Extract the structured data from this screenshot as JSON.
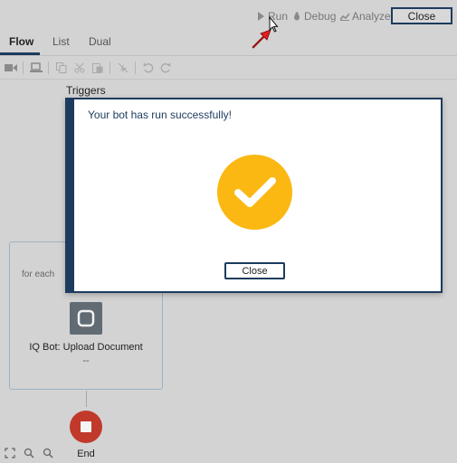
{
  "header": {
    "run_label": "Run",
    "debug_label": "Debug",
    "analyze_label": "Analyze",
    "close_label": "Close"
  },
  "tabs": [
    {
      "label": "Flow",
      "active": true
    },
    {
      "label": "List",
      "active": false
    },
    {
      "label": "Dual",
      "active": false
    }
  ],
  "toolbar": {
    "icons": [
      "record-icon",
      "deploy-icon",
      "copy-icon",
      "cut-icon",
      "paste-icon",
      "disable-icon",
      "undo-icon",
      "redo-icon"
    ]
  },
  "canvas": {
    "triggers_label": "Triggers",
    "loop_label": "for each",
    "node_title": "IQ Bot: Upload Document",
    "node_subtitle": "--",
    "end_label": "End"
  },
  "dialog": {
    "message": "Your bot has run successfully!",
    "close_label": "Close"
  },
  "colors": {
    "accent": "#1d3b5e",
    "success": "#fbb812",
    "end_node": "#c0392b",
    "overlay_bg": "#d3d3d3"
  }
}
